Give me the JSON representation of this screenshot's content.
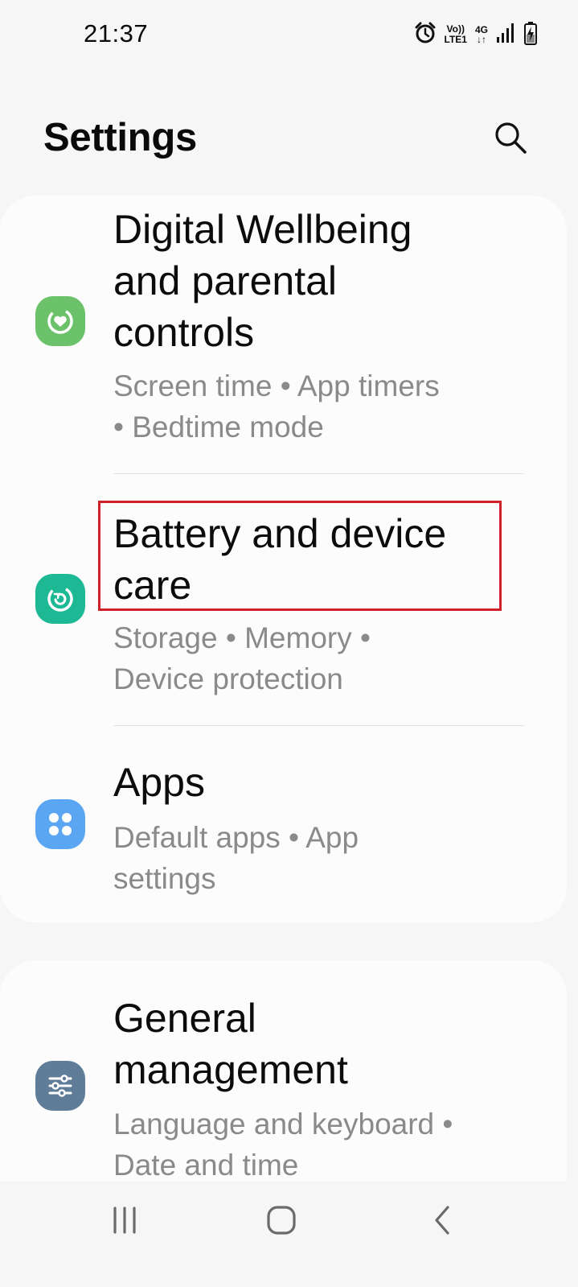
{
  "status_bar": {
    "time": "21:37",
    "volte_top": "Vo))",
    "volte_bottom": "LTE1",
    "network": "4G",
    "network_arrows": "↓↑"
  },
  "header": {
    "title": "Settings"
  },
  "items": [
    {
      "title_lines": [
        "Digital Wellbeing",
        "and parental",
        "controls"
      ],
      "subtitle_lines": [
        "Screen time  •  App timers",
        "•  Bedtime mode"
      ],
      "icon": "digital-wellbeing-icon",
      "icon_color": "#6cc26b"
    },
    {
      "title_lines": [
        "Battery and device",
        "care"
      ],
      "subtitle_lines": [
        "Storage  •  Memory  •",
        "Device protection"
      ],
      "icon": "device-care-icon",
      "icon_color": "#1db894"
    },
    {
      "title_lines": [
        "Apps"
      ],
      "subtitle_lines": [
        "Default apps  •  App",
        "settings"
      ],
      "icon": "apps-icon",
      "icon_color": "#5ba6f2"
    },
    {
      "title_lines": [
        "General",
        "management"
      ],
      "subtitle_lines": [
        "Language and keyboard  •",
        "Date and time"
      ],
      "icon": "general-management-icon",
      "icon_color": "#5f7c98"
    }
  ],
  "highlight_color": "#d0202a"
}
